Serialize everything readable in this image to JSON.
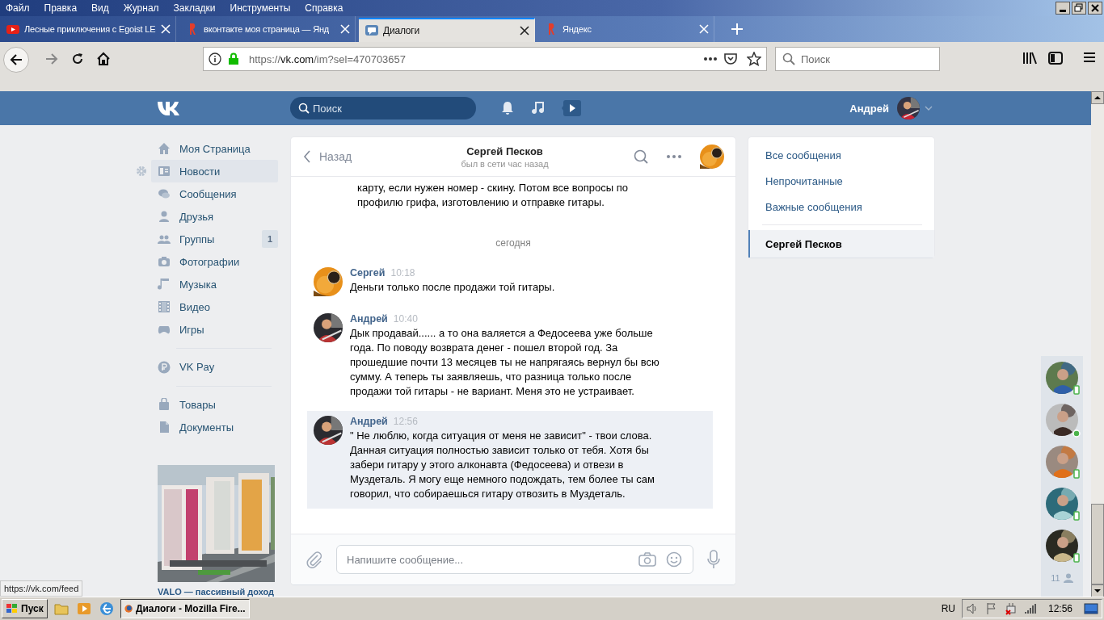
{
  "menu": [
    "Файл",
    "Правка",
    "Вид",
    "Журнал",
    "Закладки",
    "Инструменты",
    "Справка"
  ],
  "tabs": [
    {
      "title": "Лесные приключения с Egoist LE",
      "selected": false
    },
    {
      "title": "вконтакте моя страница — Янд",
      "selected": false
    },
    {
      "title": "Диалоги",
      "selected": true
    },
    {
      "title": "Яндекс",
      "selected": false
    }
  ],
  "address": {
    "scheme": "https://",
    "host": "vk.com",
    "path": "/im?sel=470703657"
  },
  "browser_search": {
    "placeholder": "Поиск"
  },
  "vk_header": {
    "search_placeholder": "Поиск",
    "user": "Андрей"
  },
  "sidebar": {
    "groups": [
      [
        {
          "label": "Моя Страница",
          "selected": false
        },
        {
          "label": "Новости",
          "selected": true
        },
        {
          "label": "Сообщения",
          "selected": false
        },
        {
          "label": "Друзья",
          "selected": false
        },
        {
          "label": "Группы",
          "selected": false,
          "badge": "1"
        },
        {
          "label": "Фотографии",
          "selected": false
        },
        {
          "label": "Музыка",
          "selected": false
        },
        {
          "label": "Видео",
          "selected": false
        },
        {
          "label": "Игры",
          "selected": false
        }
      ],
      [
        {
          "label": "VK Pay",
          "selected": false
        }
      ],
      [
        {
          "label": "Товары",
          "selected": false
        },
        {
          "label": "Документы",
          "selected": false
        }
      ]
    ],
    "ad": {
      "kind": "picture",
      "title": "VALO — пассивный доход"
    }
  },
  "chat": {
    "back": "Назад",
    "name": "Сергей Песков",
    "status": "был в сети час назад",
    "partial_text": "карту, если нужен номер - скину. Потом все вопросы по профилю грифа, изготовлению и отправке гитары.",
    "date_divider": "сегодня",
    "messages": [
      {
        "author": "Сергей",
        "time": "10:18",
        "from_me": false,
        "selected": false,
        "text": "Деньги только после продажи той гитары."
      },
      {
        "author": "Андрей",
        "time": "10:40",
        "from_me": true,
        "selected": false,
        "text": "Дык продавай...... а то она валяется а Федосеева уже больше года. По поводу возврата денег - пошел второй год. За прошедшие почти 13 месяцев ты не напрягаясь вернул бы всю сумму. А теперь ты заявляешь, что разница только после продажи той гитары - не вариант. Меня это не устраивает."
      },
      {
        "author": "Андрей",
        "time": "12:56",
        "from_me": true,
        "selected": true,
        "text": "\" Не люблю, когда ситуация от меня не зависит\" - твои слова. Данная ситуация полностью зависит только от тебя. Хотя бы забери гитару у этого алконавта (Федосеева) и отвези в Муздеталь. Я могу еще немного подождать, тем более ты сам говорил, что собираешься гитару отвозить в Муздеталь."
      }
    ],
    "composer_placeholder": "Напишите сообщение..."
  },
  "right_menu": {
    "filters": [
      {
        "label": "Все сообщения",
        "selected": false
      },
      {
        "label": "Непрочитанные",
        "selected": false
      },
      {
        "label": "Важные сообщения",
        "selected": false
      }
    ],
    "dialogs": [
      {
        "label": "Сергей Песков",
        "selected": true
      }
    ]
  },
  "contacts": {
    "items": [
      {
        "kind": "mobile"
      },
      {
        "kind": "online"
      },
      {
        "kind": "mobile"
      },
      {
        "kind": "mobile"
      },
      {
        "kind": "mobile"
      }
    ],
    "count": "11"
  },
  "status_tooltip": "https://vk.com/feed",
  "taskbar": {
    "start": "Пуск",
    "tasks": [
      {
        "label": "Диалоги - Mozilla Fire...",
        "selected": true
      }
    ],
    "language": "RU",
    "clock": "12:56"
  }
}
